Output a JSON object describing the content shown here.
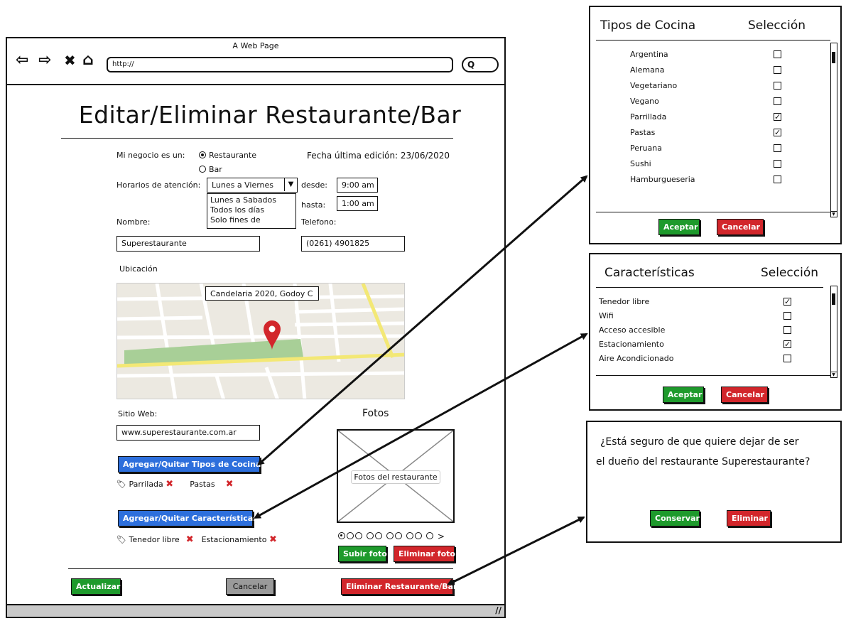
{
  "browser": {
    "title": "A Web Page",
    "url": "http://",
    "nav_icons": [
      "back-arrow-icon",
      "forward-arrow-icon",
      "close-icon",
      "home-icon"
    ]
  },
  "form": {
    "page_title": "Editar/Eliminar Restaurante/Bar",
    "business_type_label": "Mi negocio es un:",
    "option_restaurant": "Restaurante",
    "option_bar": "Bar",
    "last_edit": "Fecha última edición: 23/06/2020",
    "hours_label": "Horarios de atención:",
    "hours_selected": "Lunes a Viernes",
    "hours_options": [
      "Lunes a Sabados",
      "Todos los días",
      "Solo fines de"
    ],
    "from_label": "desde:",
    "from_value": "9:00 am",
    "to_label": "hasta:",
    "to_value": "1:00 am",
    "name_label": "Nombre:",
    "name_value": "Superestaurante",
    "phone_label": "Telefono:",
    "phone_value": "(0261) 4901825",
    "location_label": "Ubicación",
    "map_address": "Candelaria 2020, Godoy C",
    "website_label": "Sitio Web:",
    "website_value": "www.superestaurante.com.ar",
    "photos_title": "Fotos",
    "photos_placeholder": "Fotos del restaurante",
    "cuisine_button": "Agregar/Quitar Tipos de Cocina",
    "cuisine_tags": [
      "Parrilada",
      "Pastas"
    ],
    "features_button": "Agregar/Quitar Características",
    "feature_tags": [
      "Tenedor libre",
      "Estacionamiento"
    ],
    "upload_photo": "Subir foto",
    "delete_photo": "Eliminar foto",
    "pager_next": ">",
    "update_button": "Actualizar",
    "cancel_button": "Cancelar",
    "delete_button": "Eliminar Restaurante/Bar"
  },
  "cuisine_dialog": {
    "col_title": "Tipos de Cocina",
    "col_selection": "Selección",
    "items": [
      {
        "label": "Argentina",
        "checked": false
      },
      {
        "label": "Alemana",
        "checked": false
      },
      {
        "label": "Vegetariano",
        "checked": false
      },
      {
        "label": "Vegano",
        "checked": false
      },
      {
        "label": "Parrillada",
        "checked": true
      },
      {
        "label": "Pastas",
        "checked": true
      },
      {
        "label": "Peruana",
        "checked": false
      },
      {
        "label": "Sushi",
        "checked": false
      },
      {
        "label": "Hamburgueseria",
        "checked": false
      }
    ],
    "accept": "Aceptar",
    "cancel": "Cancelar"
  },
  "features_dialog": {
    "col_title": "Características",
    "col_selection": "Selección",
    "items": [
      {
        "label": "Tenedor libre",
        "checked": true
      },
      {
        "label": "Wifi",
        "checked": false
      },
      {
        "label": "Acceso accesible",
        "checked": false
      },
      {
        "label": "Estacionamiento",
        "checked": true
      },
      {
        "label": "Aire Acondicionado",
        "checked": false
      }
    ],
    "accept": "Aceptar",
    "cancel": "Cancelar"
  },
  "confirm_dialog": {
    "line1": "¿Está seguro de que quiere dejar de ser",
    "line2": "el dueño del restaurante Superestaurante?",
    "keep": "Conservar",
    "delete": "Eliminar"
  },
  "colors": {
    "blue": "#2d6fdc",
    "green": "#1e9a2c",
    "red": "#d2262b",
    "map_bg": "#ece9e1",
    "map_park": "#a8cf97",
    "map_road": "#f3e875"
  }
}
